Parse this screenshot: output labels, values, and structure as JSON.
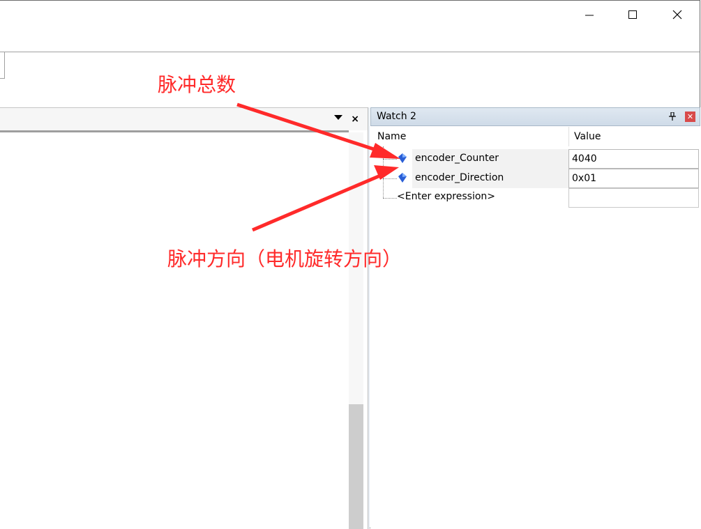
{
  "window": {
    "controls": {
      "minimize_icon": "minimize-icon",
      "maximize_icon": "maximize-icon",
      "close_icon": "close-icon"
    }
  },
  "editor": {
    "header_dropdown_icon": "triangle-down-icon",
    "header_close": "×"
  },
  "watch_panel": {
    "title": "Watch 2",
    "pin_icon": "pin-icon",
    "close_icon": "close-icon",
    "columns": {
      "name": "Name",
      "value": "Value"
    },
    "rows": [
      {
        "name": "encoder_Counter",
        "value": "4040",
        "icon": "variable-gem-icon"
      },
      {
        "name": "encoder_Direction",
        "value": "0x01",
        "icon": "variable-gem-icon"
      }
    ],
    "enter_expression": "<Enter expression>"
  },
  "annotations": {
    "pulse_total": "脉冲总数",
    "pulse_direction": "脉冲方向（电机旋转方向）",
    "color": "#ff2a2a"
  },
  "colors": {
    "annotation": "#ff2a2a",
    "watch_title_bg": "#d6e1ec",
    "close_red": "#d84a4a"
  }
}
